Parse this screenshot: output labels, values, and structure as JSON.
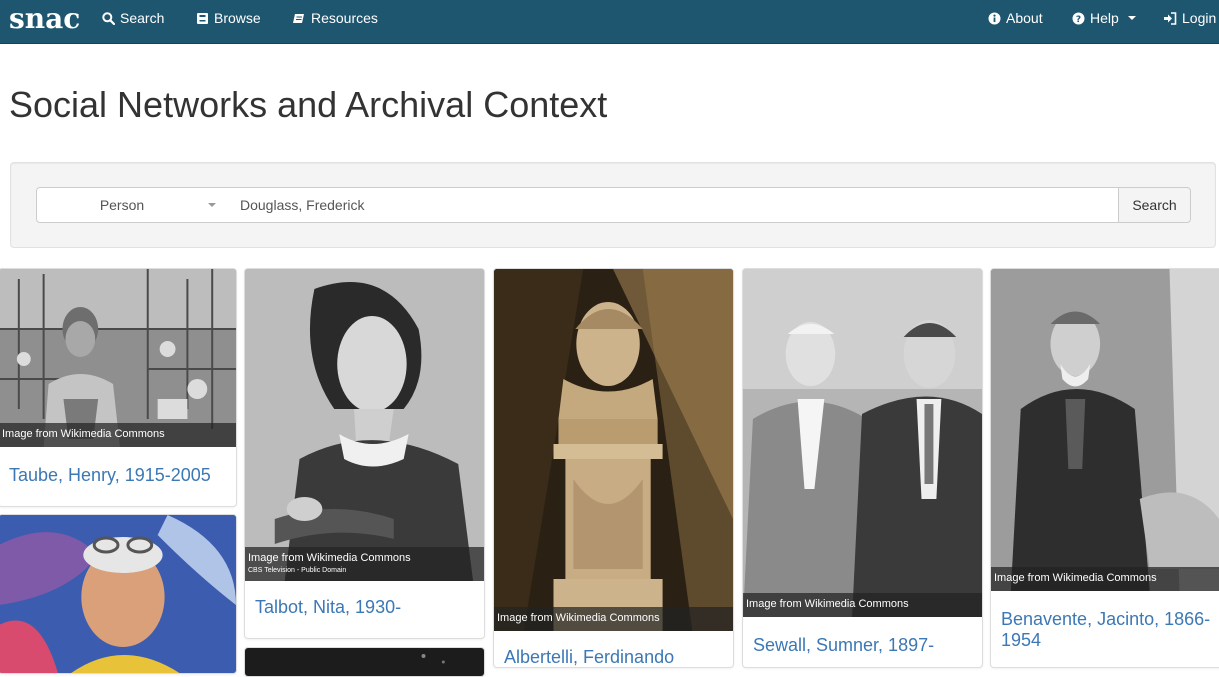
{
  "navbar": {
    "brand": "snac",
    "links": {
      "search": "Search",
      "browse": "Browse",
      "resources": "Resources",
      "about": "About",
      "help": "Help",
      "login": "Login"
    },
    "color": "#1e5670"
  },
  "page": {
    "title": "Social Networks and Archival Context"
  },
  "search": {
    "type_selected": "Person",
    "query": "Douglass, Frederick",
    "button_label": "Search"
  },
  "cards": [
    {
      "name": "Taube, Henry, 1915-2005",
      "caption": "Image from Wikimedia Commons",
      "image": "photo-man-in-lab"
    },
    {
      "name": "",
      "caption": "",
      "image": "photo-man-with-glasses-on-head"
    },
    {
      "name": "Talbot, Nita, 1930-",
      "caption": "Image from Wikimedia Commons",
      "credit": "CBS Television - Public Domain",
      "image": "photo-woman-portrait"
    },
    {
      "name": "",
      "caption": "",
      "image": "photo-dark"
    },
    {
      "name": "Albertelli, Ferdinando",
      "caption": "Image from Wikimedia Commons",
      "image": "photo-marble-bust"
    },
    {
      "name": "Sewall, Sumner, 1897-",
      "caption": "Image from Wikimedia Commons",
      "image": "photo-two-men-in-suits"
    },
    {
      "name": "Benavente, Jacinto, 1866-1954",
      "caption": "Image from Wikimedia Commons",
      "image": "photo-seated-bearded-man"
    }
  ],
  "colors": {
    "link": "#3b78b5",
    "caption_bg": "rgba(35,35,35,0.72)"
  }
}
